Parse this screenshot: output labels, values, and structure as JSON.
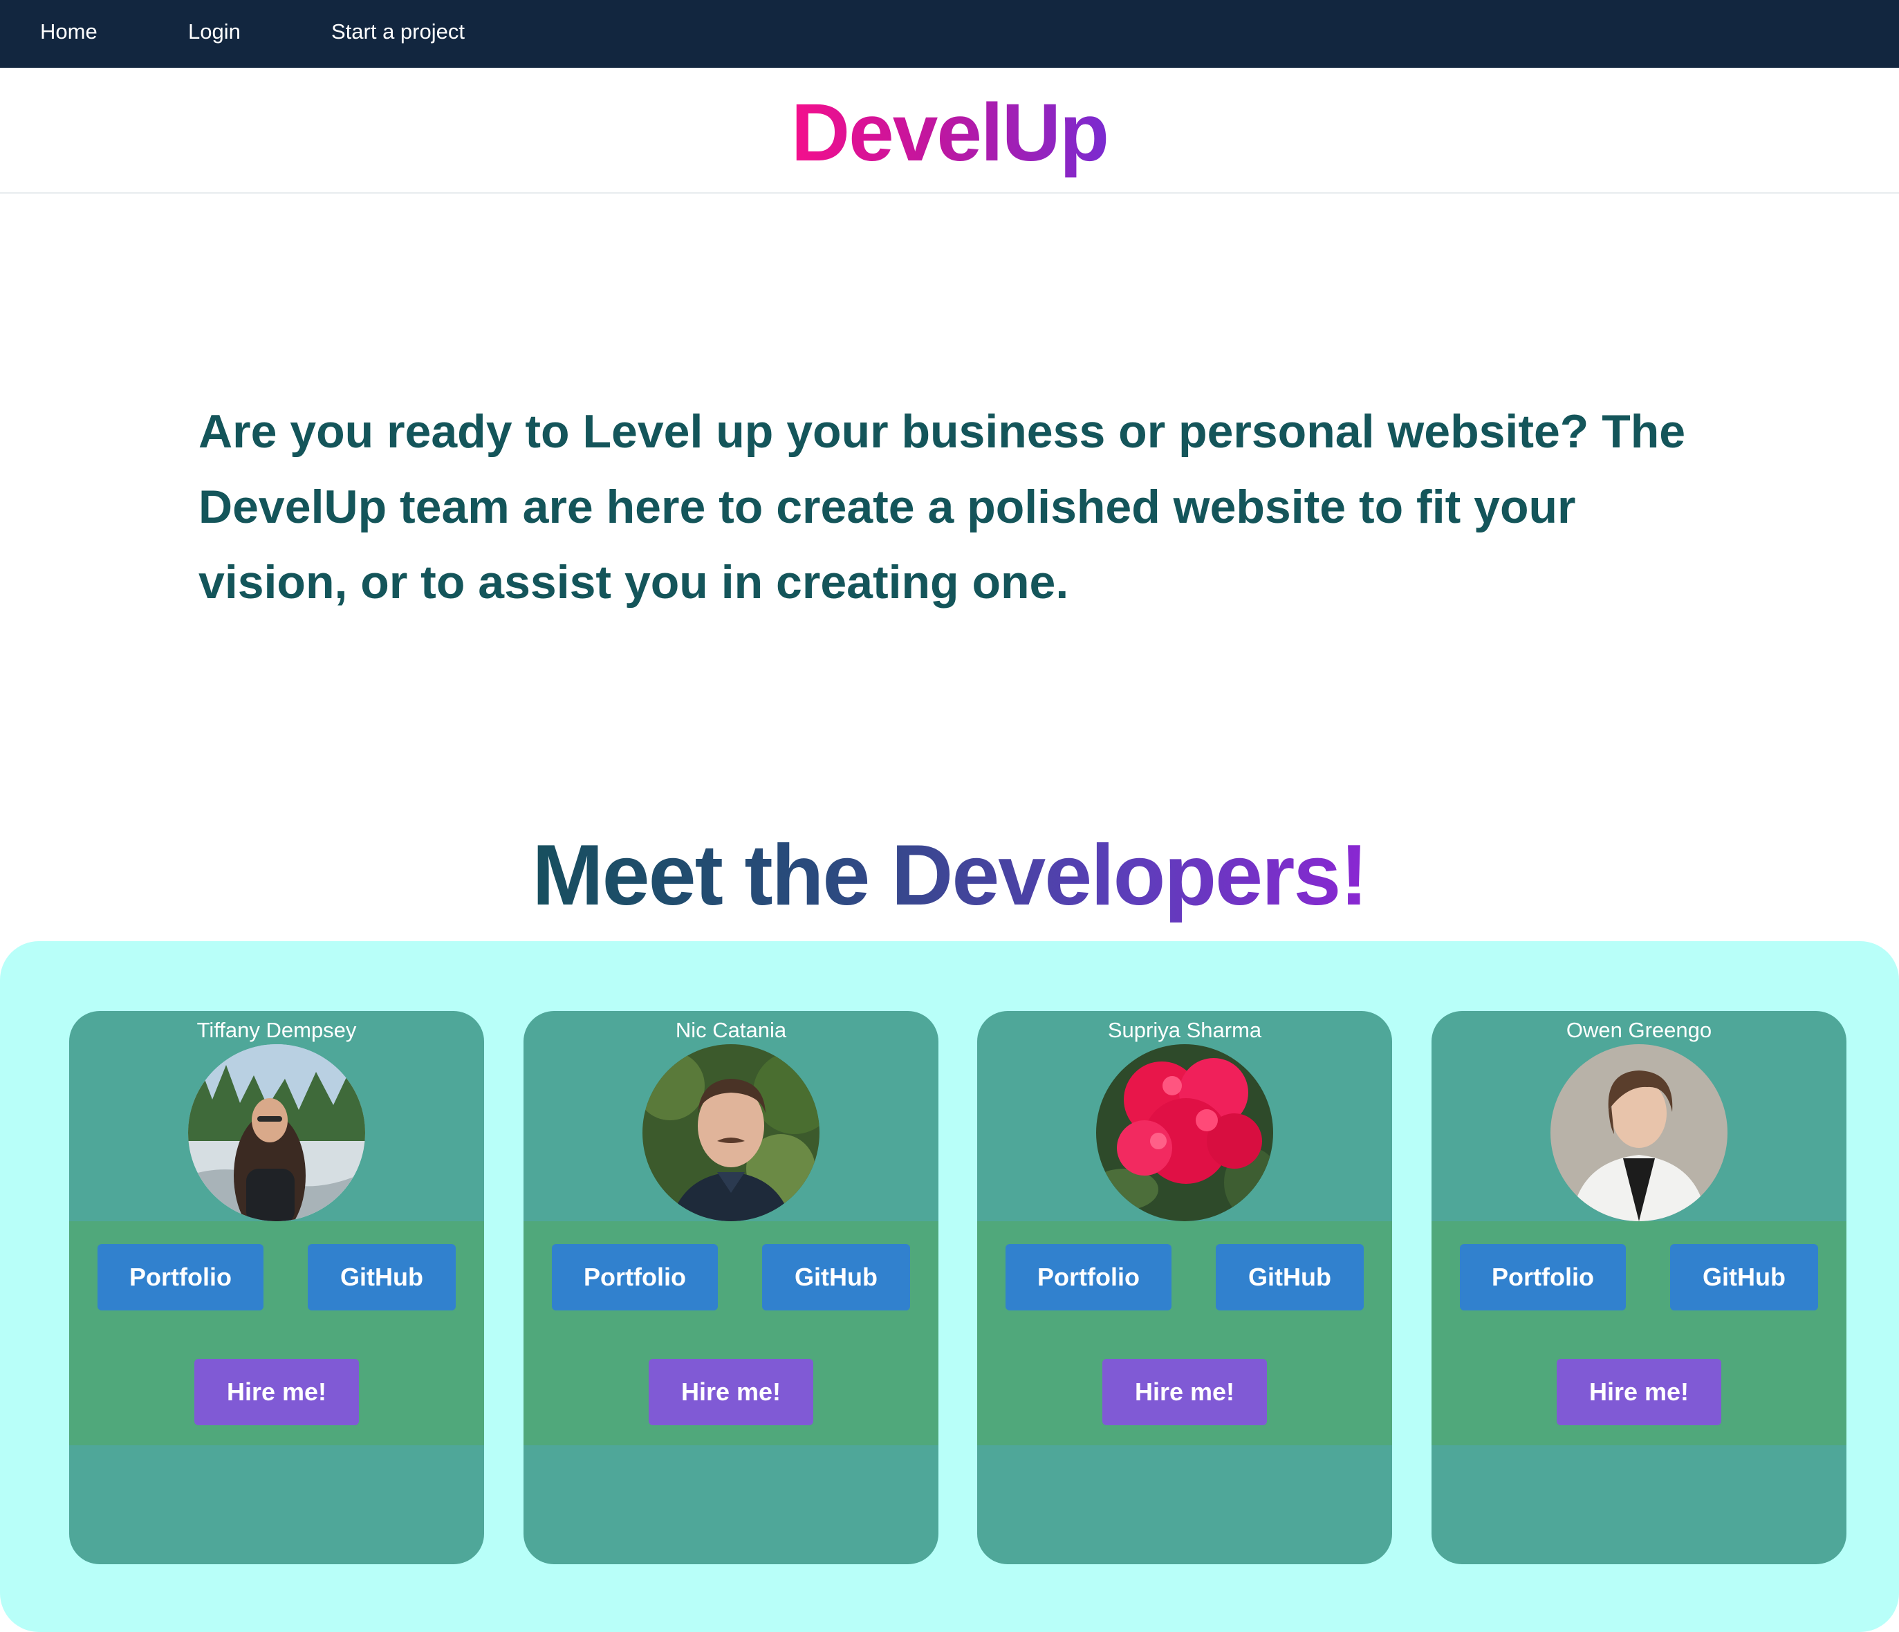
{
  "nav": {
    "home": "Home",
    "login": "Login",
    "start": "Start a project"
  },
  "brand": "DevelUp",
  "hero_text": "Are you ready to Level up your business or personal website? The DevelUp team are here to create a polished website to fit your vision, or to assist you in creating one.",
  "meet_heading": "Meet the Developers!",
  "colors": {
    "nav_bg": "#12263f",
    "hero_text": "#14555a",
    "panel_bg": "#b8fff9",
    "card_bg": "#4fa799",
    "card_actions_bg": "#50a87b",
    "btn_blue": "#3181ce",
    "btn_purple": "#805ad5",
    "brand_gradient_start": "#f40f8c",
    "brand_gradient_end": "#7a2bd0"
  },
  "developers": [
    {
      "name": "Tiffany Dempsey",
      "photo": "person-at-river-photo",
      "portfolio": "Portfolio",
      "github": "GitHub",
      "hire": "Hire me!"
    },
    {
      "name": "Nic Catania",
      "photo": "man-with-mustache-photo",
      "portfolio": "Portfolio",
      "github": "GitHub",
      "hire": "Hire me!"
    },
    {
      "name": "Supriya Sharma",
      "photo": "red-flowers-photo",
      "portfolio": "Portfolio",
      "github": "GitHub",
      "hire": "Hire me!"
    },
    {
      "name": "Owen Greengo",
      "photo": "man-in-white-jacket-photo",
      "portfolio": "Portfolio",
      "github": "GitHub",
      "hire": "Hire me!"
    }
  ]
}
